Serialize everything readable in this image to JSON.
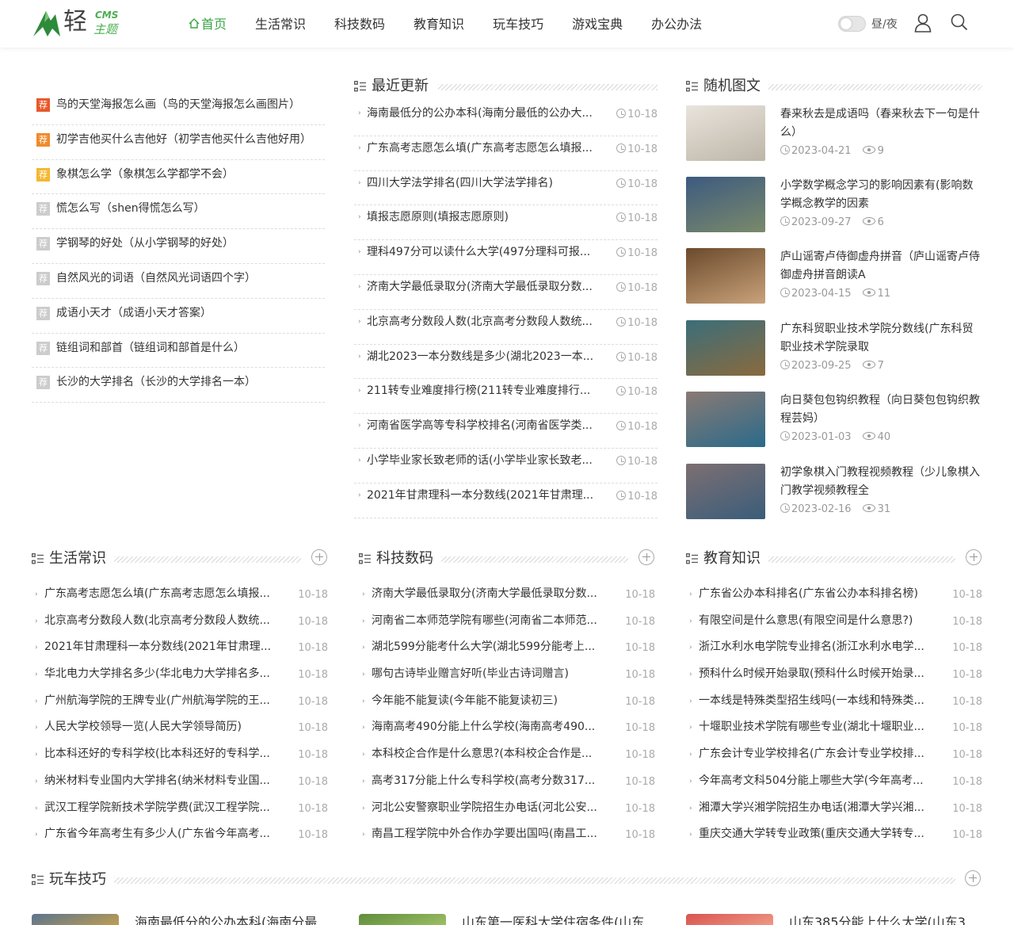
{
  "logo": {
    "char": "轻",
    "cms": "CMS",
    "sub": "主题"
  },
  "nav": [
    "首页",
    "生活常识",
    "科技数码",
    "教育知识",
    "玩车技巧",
    "游戏宝典",
    "办公办法"
  ],
  "theme_toggle": "昼/夜",
  "accent": "#3aa646",
  "recommend": {
    "badge": "荐",
    "badge_colors": [
      "#e8582b",
      "#f08a2c",
      "#f5b731",
      "#cccccc",
      "#cccccc",
      "#cccccc",
      "#cccccc",
      "#cccccc",
      "#cccccc"
    ],
    "items": [
      "鸟的天堂海报怎么画（鸟的天堂海报怎么画图片）",
      "初学吉他买什么吉他好（初学吉他买什么吉他好用）",
      "象棋怎么学（象棋怎么学都学不会）",
      "慌怎么写（shen得慌怎么写）",
      "学钢琴的好处（从小学钢琴的好处）",
      "自然风光的词语（自然风光词语四个字）",
      "成语小天才（成语小天才答案）",
      "链组词和部首（链组词和部首是什么）",
      "长沙的大学排名（长沙的大学排名一本）"
    ]
  },
  "recent": {
    "title": "最近更新",
    "items": [
      {
        "text": "海南最低分的公办本科(海南分最低的公办大...",
        "date": "10-18"
      },
      {
        "text": "广东高考志愿怎么填(广东高考志愿怎么填报...",
        "date": "10-18"
      },
      {
        "text": "四川大学法学排名(四川大学法学排名)",
        "date": "10-18"
      },
      {
        "text": "填报志愿原则(填报志愿原则)",
        "date": "10-18"
      },
      {
        "text": "理科497分可以读什么大学(497分理科可报...",
        "date": "10-18"
      },
      {
        "text": "济南大学最低录取分(济南大学最低录取分数...",
        "date": "10-18"
      },
      {
        "text": "北京高考分数段人数(北京高考分数段人数统...",
        "date": "10-18"
      },
      {
        "text": "湖北2023一本分数线是多少(湖北2023一本...",
        "date": "10-18"
      },
      {
        "text": "211转专业难度排行榜(211转专业难度排行...",
        "date": "10-18"
      },
      {
        "text": "河南省医学高等专科学校排名(河南省医学类...",
        "date": "10-18"
      },
      {
        "text": "小学毕业家长致老师的话(小学毕业家长致老...",
        "date": "10-18"
      },
      {
        "text": "2021年甘肃理科一本分数线(2021年甘肃理...",
        "date": "10-18"
      }
    ]
  },
  "random": {
    "title": "随机图文",
    "items": [
      {
        "title": "春来秋去是成语吗（春来秋去下一句是什么）",
        "date": "2023-04-21",
        "views": "9",
        "colors": [
          "#e9e4dc",
          "#bdb5a8"
        ]
      },
      {
        "title": "小学数学概念学习的影响因素有(影响数学概念教学的因素",
        "date": "2023-09-27",
        "views": "6",
        "colors": [
          "#3d5a80",
          "#7a8a6a"
        ]
      },
      {
        "title": "庐山谣寄卢侍御虚舟拼音（庐山谣寄卢侍御虚舟拼音朗读A",
        "date": "2023-04-15",
        "views": "11",
        "colors": [
          "#6b4a2c",
          "#c9a27a"
        ]
      },
      {
        "title": "广东科贸职业技术学院分数线(广东科贸职业技术学院录取",
        "date": "2023-09-25",
        "views": "7",
        "colors": [
          "#3b6e7a",
          "#8a6a3d"
        ]
      },
      {
        "title": "向日葵包包钩织教程（向日葵包包钩织教程芸妈）",
        "date": "2023-01-03",
        "views": "40",
        "colors": [
          "#8a7a74",
          "#2a6a8a"
        ]
      },
      {
        "title": "初学象棋入门教程视频教程（少儿象棋入门教学视频教程全",
        "date": "2023-02-16",
        "views": "31",
        "colors": [
          "#7d6f72",
          "#3a5d7a"
        ]
      }
    ]
  },
  "columns": [
    {
      "title": "生活常识",
      "items": [
        {
          "text": "广东高考志愿怎么填(广东高考志愿怎么填报...",
          "date": "10-18"
        },
        {
          "text": "北京高考分数段人数(北京高考分数段人数统...",
          "date": "10-18"
        },
        {
          "text": "2021年甘肃理科一本分数线(2021年甘肃理...",
          "date": "10-18"
        },
        {
          "text": "华北电力大学排名多少(华北电力大学排名多...",
          "date": "10-18"
        },
        {
          "text": "广州航海学院的王牌专业(广州航海学院的王...",
          "date": "10-18"
        },
        {
          "text": "人民大学校领导一览(人民大学领导简历)",
          "date": "10-18"
        },
        {
          "text": "比本科还好的专科学校(比本科还好的专科学...",
          "date": "10-18"
        },
        {
          "text": "纳米材料专业国内大学排名(纳米材料专业国...",
          "date": "10-18"
        },
        {
          "text": "武汉工程学院新技术学院学费(武汉工程学院...",
          "date": "10-18"
        },
        {
          "text": "广东省今年高考生有多少人(广东省今年高考...",
          "date": "10-18"
        }
      ]
    },
    {
      "title": "科技数码",
      "items": [
        {
          "text": "济南大学最低录取分(济南大学最低录取分数...",
          "date": "10-18"
        },
        {
          "text": "河南省二本师范学院有哪些(河南省二本师范...",
          "date": "10-18"
        },
        {
          "text": "湖北599分能考什么大学(湖北599分能考上...",
          "date": "10-18"
        },
        {
          "text": "哪句古诗毕业赠言好听(毕业古诗词赠言)",
          "date": "10-18"
        },
        {
          "text": "今年能不能复读(今年能不能复读初三)",
          "date": "10-18"
        },
        {
          "text": "海南高考490分能上什么学校(海南高考490...",
          "date": "10-18"
        },
        {
          "text": "本科校企合作是什么意思?(本科校企合作是...",
          "date": "10-18"
        },
        {
          "text": "高考317分能上什么专科学校(高考分数317...",
          "date": "10-18"
        },
        {
          "text": "河北公安警察职业学院招生办电话(河北公安...",
          "date": "10-18"
        },
        {
          "text": "南昌工程学院中外合作办学要出国吗(南昌工...",
          "date": "10-18"
        }
      ]
    },
    {
      "title": "教育知识",
      "items": [
        {
          "text": "广东省公办本科排名(广东省公办本科排名榜)",
          "date": "10-18"
        },
        {
          "text": "有限空间是什么意思(有限空间是什么意思?)",
          "date": "10-18"
        },
        {
          "text": "浙江水利水电学院专业排名(浙江水利水电学...",
          "date": "10-18"
        },
        {
          "text": "预科什么时候开始录取(预科什么时候开始录...",
          "date": "10-18"
        },
        {
          "text": "一本线是特殊类型招生线吗(一本线和特殊类...",
          "date": "10-18"
        },
        {
          "text": "十堰职业技术学院有哪些专业(湖北十堰职业...",
          "date": "10-18"
        },
        {
          "text": "广东会计专业学校排名(广东会计专业学校排...",
          "date": "10-18"
        },
        {
          "text": "今年高考文科504分能上哪些大学(今年高考...",
          "date": "10-18"
        },
        {
          "text": "湘潭大学兴湘学院招生办电话(湘潭大学兴湘...",
          "date": "10-18"
        },
        {
          "text": "重庆交通大学转专业政策(重庆交通大学转专...",
          "date": "10-18"
        }
      ]
    }
  ],
  "car": {
    "title": "玩车技巧",
    "items": [
      {
        "text": "海南最低分的公办本科(海南分最",
        "colors": [
          "#5a7390",
          "#c9a34a"
        ]
      },
      {
        "text": "山东第一医科大学住宿条件(山东",
        "colors": [
          "#5f8c3a",
          "#a3c46a"
        ]
      },
      {
        "text": "山东385分能上什么大学(山东3",
        "colors": [
          "#d9534f",
          "#f0a08a"
        ]
      }
    ]
  }
}
